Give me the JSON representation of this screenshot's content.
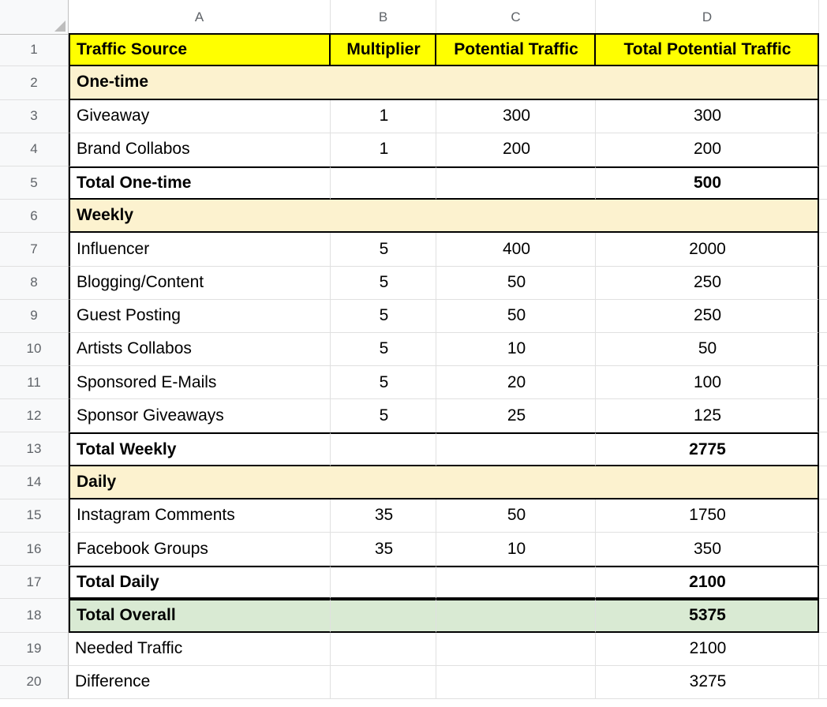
{
  "columns": [
    "A",
    "B",
    "C",
    "D"
  ],
  "rowNumbers": [
    "1",
    "2",
    "3",
    "4",
    "5",
    "6",
    "7",
    "8",
    "9",
    "10",
    "11",
    "12",
    "13",
    "14",
    "15",
    "16",
    "17",
    "18",
    "19",
    "20"
  ],
  "header": {
    "A": "Traffic Source",
    "B": "Multiplier",
    "C": "Potential Traffic",
    "D": "Total Potential Traffic"
  },
  "rows": {
    "2": {
      "A": "One-time"
    },
    "3": {
      "A": "Giveaway",
      "B": "1",
      "C": "300",
      "D": "300"
    },
    "4": {
      "A": "Brand Collabos",
      "B": "1",
      "C": "200",
      "D": "200"
    },
    "5": {
      "A": "Total One-time",
      "D": "500"
    },
    "6": {
      "A": "Weekly"
    },
    "7": {
      "A": "Influencer",
      "B": "5",
      "C": "400",
      "D": "2000"
    },
    "8": {
      "A": "Blogging/Content",
      "B": "5",
      "C": "50",
      "D": "250"
    },
    "9": {
      "A": "Guest Posting",
      "B": "5",
      "C": "50",
      "D": "250"
    },
    "10": {
      "A": "Artists Collabos",
      "B": "5",
      "C": "10",
      "D": "50"
    },
    "11": {
      "A": "Sponsored E-Mails",
      "B": "5",
      "C": "20",
      "D": "100"
    },
    "12": {
      "A": "Sponsor Giveaways",
      "B": "5",
      "C": "25",
      "D": "125"
    },
    "13": {
      "A": "Total Weekly",
      "D": "2775"
    },
    "14": {
      "A": "Daily"
    },
    "15": {
      "A": "Instagram Comments",
      "B": "35",
      "C": "50",
      "D": "1750"
    },
    "16": {
      "A": "Facebook Groups",
      "B": "35",
      "C": "10",
      "D": "350"
    },
    "17": {
      "A": "Total Daily",
      "D": "2100"
    },
    "18": {
      "A": "Total Overall",
      "D": "5375"
    },
    "19": {
      "A": "Needed Traffic",
      "D": "2100"
    },
    "20": {
      "A": "Difference",
      "D": "3275"
    }
  }
}
